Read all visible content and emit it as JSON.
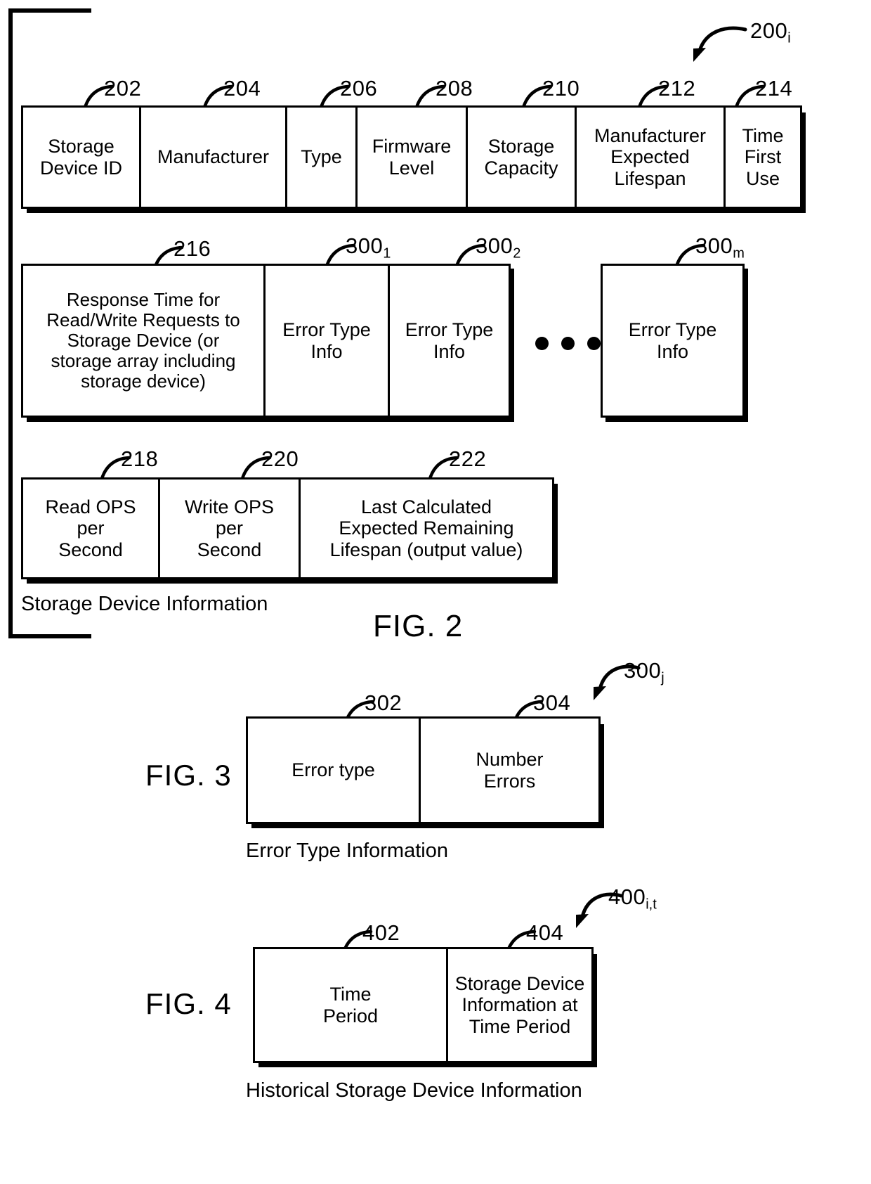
{
  "figure2": {
    "group_callout": "200",
    "group_callout_sub": "i",
    "caption": "Storage Device Information",
    "fig_label": "FIG. 2",
    "row1": [
      {
        "ref": "202",
        "ref_sub": "",
        "label": "Storage\nDevice ID"
      },
      {
        "ref": "204",
        "ref_sub": "",
        "label": "Manufacturer"
      },
      {
        "ref": "206",
        "ref_sub": "",
        "label": "Type"
      },
      {
        "ref": "208",
        "ref_sub": "",
        "label": "Firmware\nLevel"
      },
      {
        "ref": "210",
        "ref_sub": "",
        "label": "Storage\nCapacity"
      },
      {
        "ref": "212",
        "ref_sub": "",
        "label": "Manufacturer\nExpected\nLifespan"
      },
      {
        "ref": "214",
        "ref_sub": "",
        "label": "Time\nFirst\nUse"
      }
    ],
    "row2": [
      {
        "ref": "216",
        "ref_sub": "",
        "label": "Response Time for\nRead/Write Requests to\nStorage Device (or\nstorage array including\nstorage device)"
      },
      {
        "ref": "300",
        "ref_sub": "1",
        "label": "Error Type\nInfo"
      },
      {
        "ref": "300",
        "ref_sub": "2",
        "label": "Error Type\nInfo"
      },
      {
        "ref": "300",
        "ref_sub": "m",
        "label": "Error Type\nInfo"
      }
    ],
    "row2_ellipsis": "• • •",
    "row3": [
      {
        "ref": "218",
        "ref_sub": "",
        "label": "Read OPS\nper\nSecond"
      },
      {
        "ref": "220",
        "ref_sub": "",
        "label": "Write OPS\nper\nSecond"
      },
      {
        "ref": "222",
        "ref_sub": "",
        "label": "Last Calculated\nExpected Remaining\nLifespan (output value)"
      }
    ]
  },
  "figure3": {
    "fig_label": "FIG. 3",
    "group_callout": "300",
    "group_callout_sub": "j",
    "caption": "Error Type Information",
    "cells": [
      {
        "ref": "302",
        "label": "Error type"
      },
      {
        "ref": "304",
        "label": "Number\nErrors"
      }
    ]
  },
  "figure4": {
    "fig_label": "FIG. 4",
    "group_callout": "400",
    "group_callout_sub": "i,t",
    "caption": "Historical Storage Device Information",
    "cells": [
      {
        "ref": "402",
        "label": "Time\nPeriod"
      },
      {
        "ref": "404",
        "label": "Storage Device\nInformation at\nTime Period"
      }
    ]
  },
  "colors": {
    "ink": "#000000",
    "paper": "#ffffff"
  }
}
